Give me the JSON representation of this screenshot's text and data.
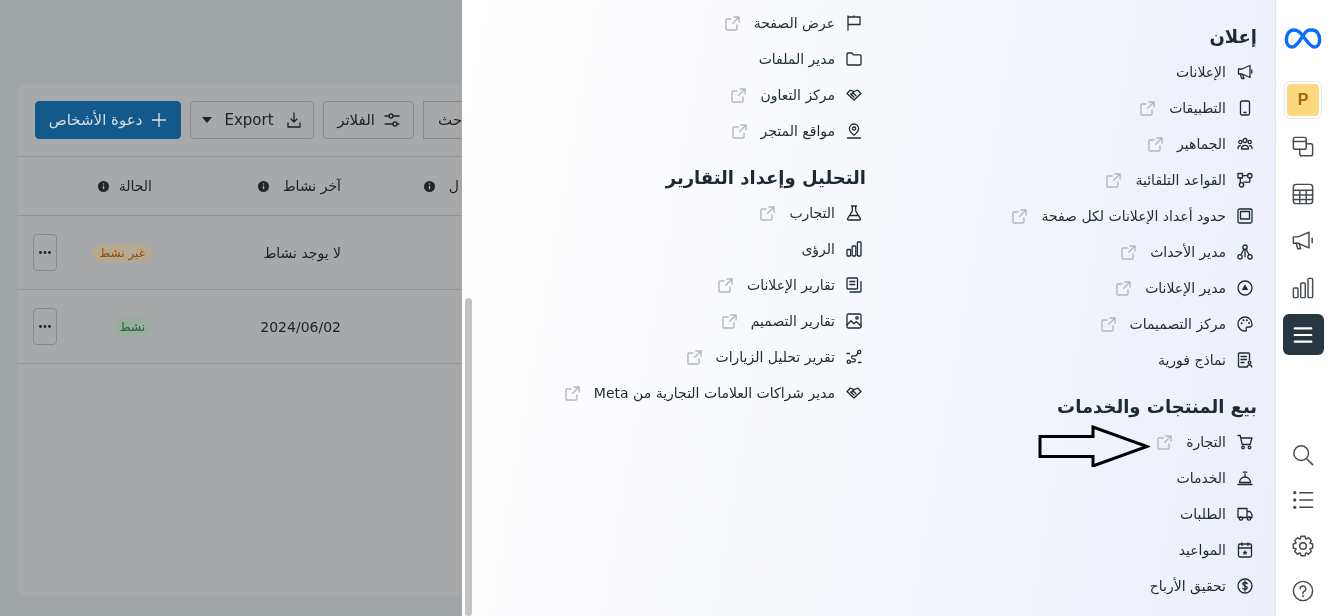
{
  "background_page": {
    "toolbar": {
      "search_button": "حث",
      "filters_button": "الفلاتر",
      "export_button": "Export",
      "invite_button": "دعوة الأشخاص"
    },
    "table": {
      "columns": [
        "ل",
        "آخر نشاط",
        "الحالة"
      ],
      "rows": [
        {
          "last_activity": "لا يوجد نشاط",
          "status": "غير نشط",
          "active": false
        },
        {
          "last_activity": "2024/06/02",
          "status": "نشط",
          "active": true
        }
      ]
    }
  },
  "menu": {
    "columns": [
      {
        "sections": [
          {
            "title": "إعلان",
            "items": [
              {
                "label": "الإعلانات",
                "external_link": false
              },
              {
                "label": "التطبيقات",
                "external_link": true
              },
              {
                "label": "الجماهير",
                "external_link": true
              },
              {
                "label": "القواعد التلقائية",
                "external_link": true
              },
              {
                "label": "حدود أعداد الإعلانات لكل صفحة",
                "external_link": true
              },
              {
                "label": "مدير الأحداث",
                "external_link": true
              },
              {
                "label": "مدير الإعلانات",
                "external_link": true
              },
              {
                "label": "مركز التصميمات",
                "external_link": true
              },
              {
                "label": "نماذج فورية",
                "external_link": false
              }
            ]
          },
          {
            "title": "بيع المنتجات والخدمات",
            "items": [
              {
                "label": "التجارة",
                "external_link": true
              },
              {
                "label": "الخدمات",
                "external_link": false
              },
              {
                "label": "الطلبات",
                "external_link": false
              },
              {
                "label": "المواعيد",
                "external_link": false
              },
              {
                "label": "تحقيق الأرباح",
                "external_link": false
              }
            ]
          }
        ]
      },
      {
        "sections": [
          {
            "items": [
              {
                "label": "عرض الصفحة",
                "external_link": true
              },
              {
                "label": "مدير الملفات",
                "external_link": false
              },
              {
                "label": "مركز التعاون",
                "external_link": true
              },
              {
                "label": "مواقع المتجر",
                "external_link": true
              }
            ]
          },
          {
            "title": "التحليل وإعداد التقارير",
            "items": [
              {
                "label": "التجارب",
                "external_link": true
              },
              {
                "label": "الرؤى",
                "external_link": false
              },
              {
                "label": "تقارير الإعلانات",
                "external_link": true
              },
              {
                "label": "تقارير التصميم",
                "external_link": true
              },
              {
                "label": "تقرير تحليل الزيارات",
                "external_link": true
              },
              {
                "label": "مدير شراكات العلامات التجارية من Meta",
                "external_link": true
              }
            ]
          }
        ]
      }
    ]
  },
  "rail": {
    "avatar": "P",
    "items": [
      {
        "selected": false
      },
      {
        "selected": false
      },
      {
        "selected": false
      },
      {
        "selected": false
      },
      {
        "selected": true
      }
    ]
  }
}
